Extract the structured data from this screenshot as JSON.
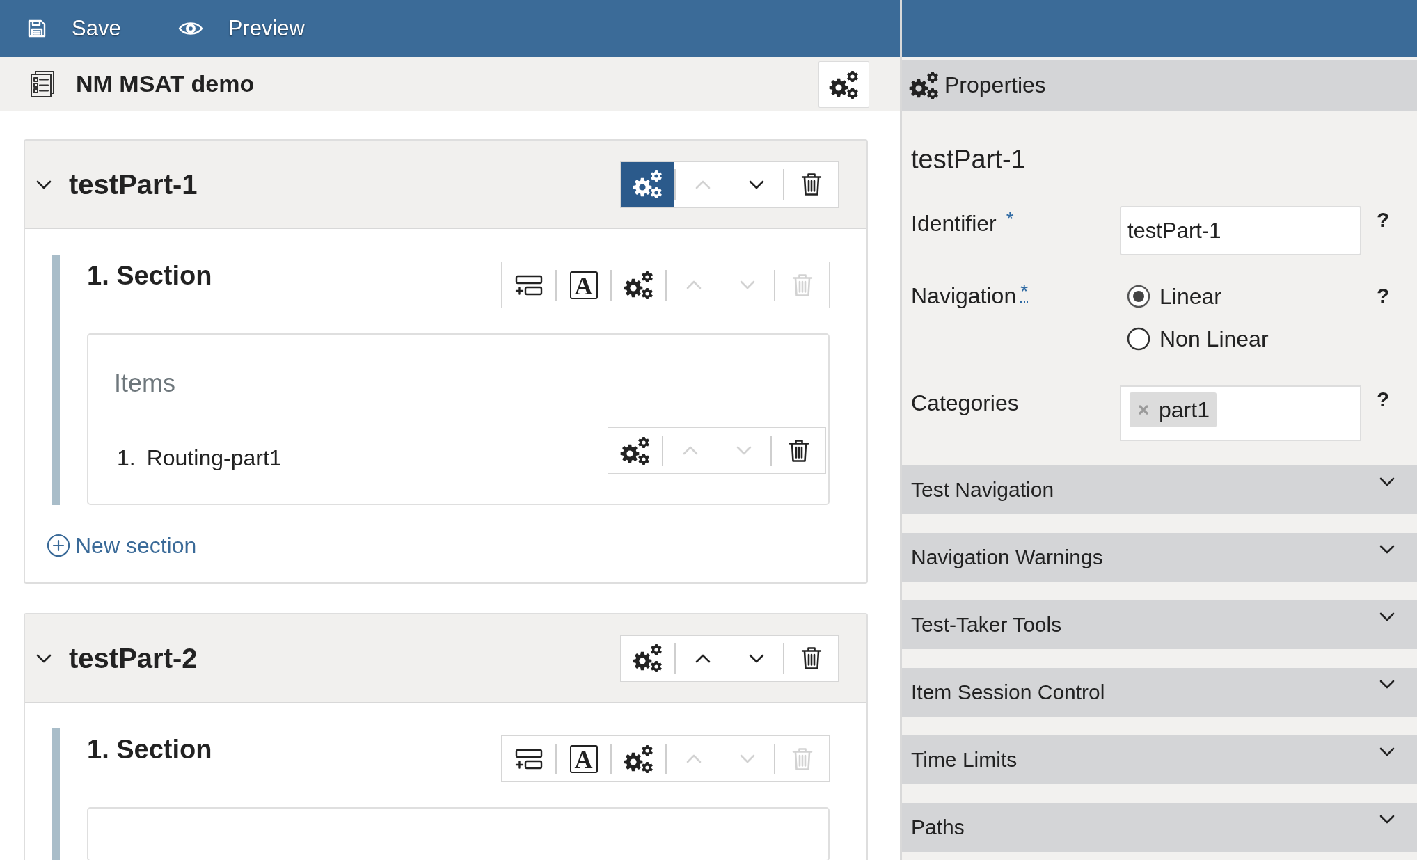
{
  "toolbar": [
    {
      "kind": "save",
      "label": "Save"
    },
    {
      "kind": "preview",
      "label": "Preview"
    }
  ],
  "test": {
    "title": "NM MSAT demo"
  },
  "test_parts": [
    {
      "title": "testPart-1",
      "expanded": true,
      "toolbar": [
        {
          "kind": "settings",
          "active": true,
          "disabled": false
        },
        {
          "kind": "up",
          "active": false,
          "disabled": true
        },
        {
          "kind": "down",
          "active": false,
          "disabled": false
        },
        {
          "kind": "delete",
          "active": false,
          "disabled": false
        }
      ],
      "sections": [
        {
          "title": "1. Section",
          "toolbar": [
            {
              "kind": "add-section",
              "active": false,
              "disabled": false
            },
            {
              "kind": "text",
              "glyph": "A",
              "active": false,
              "disabled": false
            },
            {
              "kind": "settings",
              "active": false,
              "disabled": false
            },
            {
              "kind": "up",
              "active": false,
              "disabled": true
            },
            {
              "kind": "down",
              "active": false,
              "disabled": true
            },
            {
              "kind": "delete",
              "active": false,
              "disabled": true
            }
          ],
          "items_heading": "Items",
          "items": [
            {
              "number": "1.",
              "label": "Routing-part1",
              "toolbar": [
                {
                  "kind": "settings",
                  "active": false,
                  "disabled": false
                },
                {
                  "kind": "up",
                  "active": false,
                  "disabled": true
                },
                {
                  "kind": "down",
                  "active": false,
                  "disabled": true
                },
                {
                  "kind": "delete",
                  "active": false,
                  "disabled": false
                }
              ]
            }
          ]
        }
      ],
      "new_section": "New section"
    },
    {
      "title": "testPart-2",
      "expanded": true,
      "toolbar": [
        {
          "kind": "settings",
          "active": false,
          "disabled": false
        },
        {
          "kind": "up",
          "active": false,
          "disabled": false
        },
        {
          "kind": "down",
          "active": false,
          "disabled": false
        },
        {
          "kind": "delete",
          "active": false,
          "disabled": false
        }
      ],
      "sections": [
        {
          "title": "1. Section",
          "toolbar": [
            {
              "kind": "add-section",
              "active": false,
              "disabled": false
            },
            {
              "kind": "text",
              "glyph": "A",
              "active": false,
              "disabled": false
            },
            {
              "kind": "settings",
              "active": false,
              "disabled": false
            },
            {
              "kind": "up",
              "active": false,
              "disabled": true
            },
            {
              "kind": "down",
              "active": false,
              "disabled": true
            },
            {
              "kind": "delete",
              "active": false,
              "disabled": true
            }
          ]
        }
      ]
    }
  ],
  "properties": {
    "title": "Properties",
    "heading": "testPart-1",
    "fields": [
      {
        "kind": "text",
        "label": "Identifier",
        "required_mark": "*",
        "dotted_underline": false,
        "value": "testPart-1",
        "help": "?"
      },
      {
        "kind": "radio",
        "label": "Navigation",
        "required_mark": "*",
        "dotted_underline": true,
        "options": [
          {
            "label": "Linear",
            "selected": true
          },
          {
            "label": "Non Linear",
            "selected": false
          }
        ],
        "help": "?"
      },
      {
        "kind": "tags",
        "label": "Categories",
        "tags": [
          "part1"
        ],
        "help": "?"
      }
    ],
    "sections": [
      {
        "title": "Test Navigation",
        "expanded": false
      },
      {
        "title": "Navigation Warnings",
        "expanded": false
      },
      {
        "title": "Test-Taker Tools",
        "expanded": false
      },
      {
        "title": "Item Session Control",
        "expanded": false
      },
      {
        "title": "Time Limits",
        "expanded": false
      },
      {
        "title": "Paths",
        "expanded": false
      }
    ]
  }
}
